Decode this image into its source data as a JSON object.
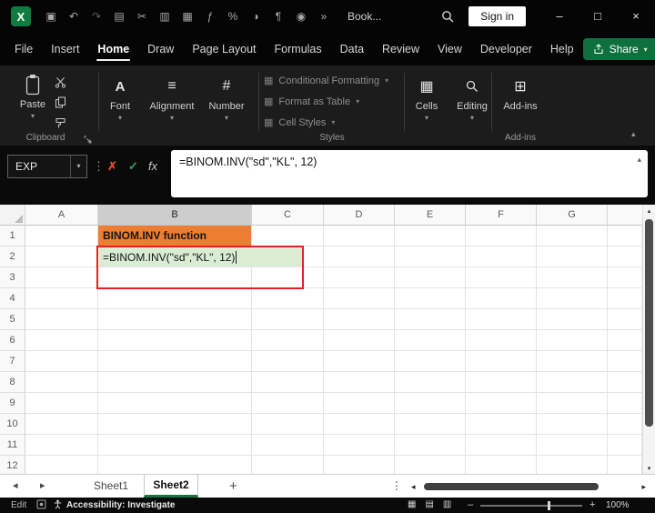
{
  "colors": {
    "excel_green": "#107C41",
    "share_green": "#0E703C",
    "tab_underline_green": "#1E7145",
    "orange_fill": "#ED7D31",
    "edit_fill_green": "#D9EDD4",
    "selection_red": "#E52222"
  },
  "title_bar": {
    "app_title": "Book...",
    "sign_in_label": "Sign in",
    "qat_icons": [
      {
        "name": "save-icon",
        "glyph": "▣"
      },
      {
        "name": "undo-icon",
        "glyph": "↶"
      },
      {
        "name": "redo-icon",
        "glyph": "↷"
      },
      {
        "name": "copy-icon",
        "glyph": "▤"
      },
      {
        "name": "cut-icon",
        "glyph": "✂"
      },
      {
        "name": "paste-icon",
        "glyph": "▥"
      },
      {
        "name": "picture-icon",
        "glyph": "▦"
      },
      {
        "name": "formula-icon",
        "glyph": "ƒ"
      },
      {
        "name": "percent-icon",
        "glyph": "%"
      },
      {
        "name": "theme-icon",
        "glyph": "◑"
      },
      {
        "name": "paragraph-icon",
        "glyph": "¶"
      },
      {
        "name": "camera-icon",
        "glyph": "◉"
      },
      {
        "name": "more-commands-icon",
        "glyph": "»"
      }
    ],
    "window_controls": {
      "minimize": "–",
      "maximize": "□",
      "close": "×"
    }
  },
  "menu_bar": {
    "items": [
      "File",
      "Insert",
      "Home",
      "Draw",
      "Page Layout",
      "Formulas",
      "Data",
      "Review",
      "View",
      "Developer",
      "Help"
    ],
    "active_item": "Home",
    "share_label": "Share"
  },
  "ribbon": {
    "clipboard": {
      "paste_label": "Paste",
      "group_label": "Clipboard"
    },
    "font": {
      "label": "Font"
    },
    "alignment": {
      "label": "Alignment"
    },
    "number": {
      "label": "Number"
    },
    "styles": {
      "items": [
        "Conditional Formatting",
        "Format as Table",
        "Cell Styles"
      ],
      "group_label": "Styles"
    },
    "cells": {
      "label": "Cells"
    },
    "editing": {
      "label": "Editing"
    },
    "addins": {
      "label": "Add-ins",
      "group_label": "Add-ins"
    }
  },
  "formula_bar": {
    "name_box_value": "EXP",
    "fx_label": "fx",
    "formula": "=BINOM.INV(\"sd\",\"KL\", 12)"
  },
  "grid": {
    "column_headers": [
      "A",
      "B",
      "C",
      "D",
      "E",
      "F",
      "G"
    ],
    "selected_column": "B",
    "row_headers": [
      "1",
      "2",
      "3",
      "4",
      "5",
      "6",
      "7",
      "8",
      "9",
      "10",
      "11",
      "12"
    ],
    "cell_b1": "BINOM.INV function",
    "cell_b2": "=BINOM.INV(\"sd\",\"KL\", 12)"
  },
  "sheet_bar": {
    "tabs": [
      {
        "label": "Sheet1",
        "active": false
      },
      {
        "label": "Sheet2",
        "active": true
      }
    ],
    "add_sheet_label": "+"
  },
  "status_bar": {
    "mode": "Edit",
    "accessibility_text": "Accessibility: Investigate",
    "zoom_value": "100%"
  },
  "icons": {
    "excel_logo": "X",
    "chevron_down": "▾",
    "chevron_up": "▴",
    "dots_vertical": "⋮",
    "cancel": "✗",
    "enter": "✓",
    "font": "A",
    "alignment": "≡",
    "number": "#",
    "cells": "▦",
    "addins": "⊞",
    "styles_item": "▦",
    "tab_prev": "◂",
    "tab_next": "▸",
    "tab_menu": "⋮",
    "scroll_up": "▴",
    "scroll_down": "▾",
    "hscroll_left": "◂",
    "hscroll_right": "▸",
    "view_normal": "▦",
    "view_layout": "▤",
    "view_break": "▥",
    "zoom_minus": "–",
    "zoom_plus": "+"
  }
}
